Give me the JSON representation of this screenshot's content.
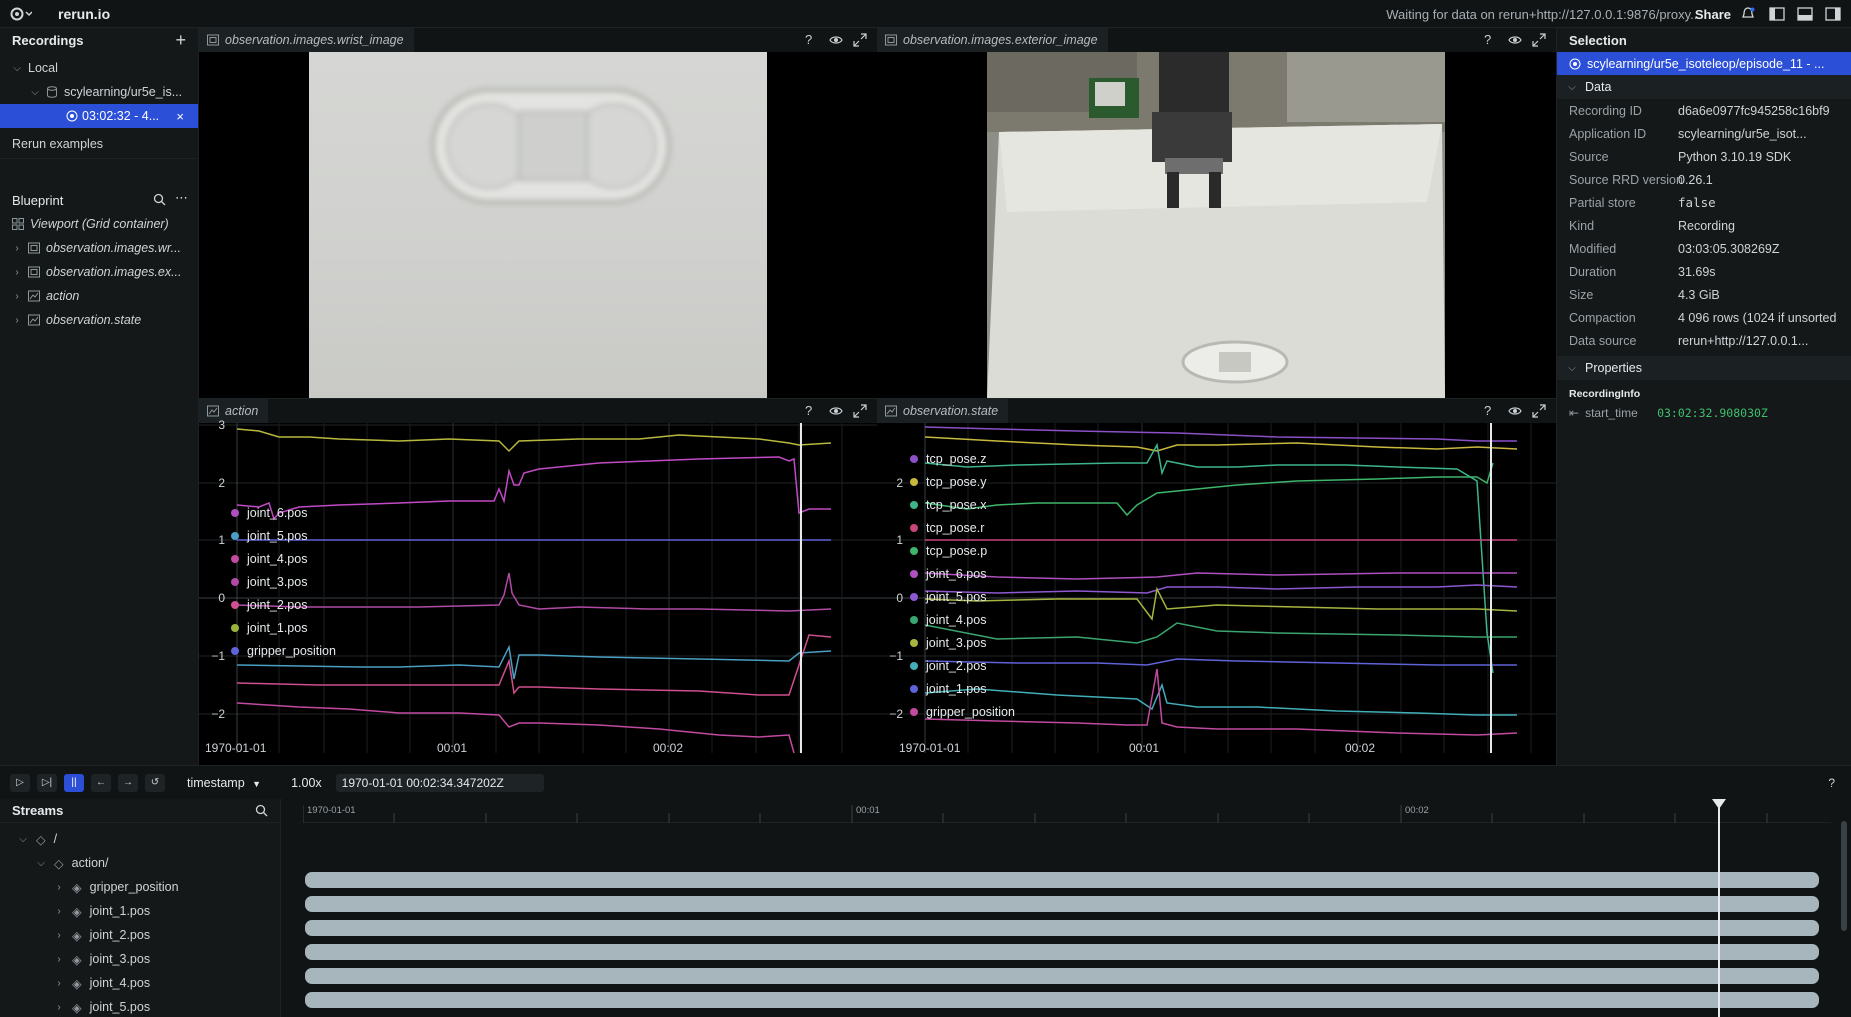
{
  "topbar": {
    "app_title": "rerun.io",
    "status": "Waiting for data on rerun+http://127.0.0.1:9876/proxy...",
    "share_label": "Share"
  },
  "recordings": {
    "header": "Recordings",
    "local_label": "Local",
    "app_label": "scylearning/ur5e_is...",
    "recording_label": "03:02:32 - 4...",
    "examples_label": "Rerun examples"
  },
  "blueprint": {
    "header": "Blueprint",
    "viewport_label": "Viewport (Grid container)",
    "items": [
      {
        "label": "observation.images.wr...",
        "icon": "image-icon"
      },
      {
        "label": "observation.images.ex...",
        "icon": "image-icon"
      },
      {
        "label": "action",
        "icon": "timeseries-icon"
      },
      {
        "label": "observation.state",
        "icon": "timeseries-icon"
      }
    ]
  },
  "views": {
    "wrist_title": "observation.images.wrist_image",
    "exterior_title": "observation.images.exterior_image",
    "action_title": "action",
    "state_title": "observation.state"
  },
  "action_plot": {
    "y_ticks": [
      "3",
      "2",
      "1",
      "0",
      "−1",
      "−2"
    ],
    "x_ticks": [
      "1970-01-01",
      "00:01",
      "00:02"
    ],
    "legend": [
      {
        "name": "joint_6.pos",
        "color": "#b04fbf"
      },
      {
        "name": "joint_5.pos",
        "color": "#4a9fc2"
      },
      {
        "name": "joint_4.pos",
        "color": "#c24aa0"
      },
      {
        "name": "joint_3.pos",
        "color": "#b14aa6"
      },
      {
        "name": "joint_2.pos",
        "color": "#d04f8e"
      },
      {
        "name": "joint_1.pos",
        "color": "#9ab43c"
      },
      {
        "name": "gripper_position",
        "color": "#5f63d8"
      }
    ]
  },
  "state_plot": {
    "y_ticks": [
      "2",
      "1",
      "0",
      "−1",
      "−2"
    ],
    "x_ticks": [
      "1970-01-01",
      "00:01",
      "00:02"
    ],
    "legend": [
      {
        "name": "tcp_pose.z",
        "color": "#8b4fc7"
      },
      {
        "name": "tcp_pose.y",
        "color": "#c8b83e"
      },
      {
        "name": "tcp_pose.x",
        "color": "#3eb58a"
      },
      {
        "name": "tcp_pose.r",
        "color": "#c9457a"
      },
      {
        "name": "tcp_pose.p",
        "color": "#3db56b"
      },
      {
        "name": "joint_6.pos",
        "color": "#b04fbf"
      },
      {
        "name": "joint_5.pos",
        "color": "#8e58d0"
      },
      {
        "name": "joint_4.pos",
        "color": "#3aa56f"
      },
      {
        "name": "joint_3.pos",
        "color": "#a7b43f"
      },
      {
        "name": "joint_2.pos",
        "color": "#42aeb8"
      },
      {
        "name": "joint_1.pos",
        "color": "#5f63d8"
      },
      {
        "name": "gripper_position",
        "color": "#c24aa0"
      }
    ]
  },
  "selection": {
    "header": "Selection",
    "selected_item": "scylearning/ur5e_isoteleop/episode_11 - ...",
    "data_header": "Data",
    "rows": [
      {
        "k": "Recording ID",
        "v": "d6a6e0977fc945258c16bf9"
      },
      {
        "k": "Application ID",
        "v": "scylearning/ur5e_isot..."
      },
      {
        "k": "Source",
        "v": "Python 3.10.19 SDK"
      },
      {
        "k": "Source RRD version",
        "v": "0.26.1"
      },
      {
        "k": "Partial store",
        "v": "false"
      },
      {
        "k": "Kind",
        "v": "Recording"
      },
      {
        "k": "Modified",
        "v": "03:03:05.308269Z"
      },
      {
        "k": "Duration",
        "v": "31.69s"
      },
      {
        "k": "Size",
        "v": "4.3 GiB"
      },
      {
        "k": "Compaction",
        "v": "4 096 rows (1024 if unsorted"
      },
      {
        "k": "Data source",
        "v": "rerun+http://127.0.0.1..."
      }
    ],
    "properties_header": "Properties",
    "recording_info_label": "RecordingInfo",
    "start_time_key": "start_time",
    "start_time_value": "03:02:32.908030Z"
  },
  "timebar": {
    "timeline": "timestamp",
    "speed": "1.00x",
    "current_time": "1970-01-01 00:02:34.347202Z",
    "help": "?"
  },
  "streams": {
    "header": "Streams",
    "root": "/",
    "action": "action/",
    "items": [
      "gripper_position",
      "joint_1.pos",
      "joint_2.pos",
      "joint_3.pos",
      "joint_4.pos",
      "joint_5.pos"
    ]
  },
  "timeline_ticks": [
    "1970-01-01",
    "00:01",
    "00:02"
  ]
}
